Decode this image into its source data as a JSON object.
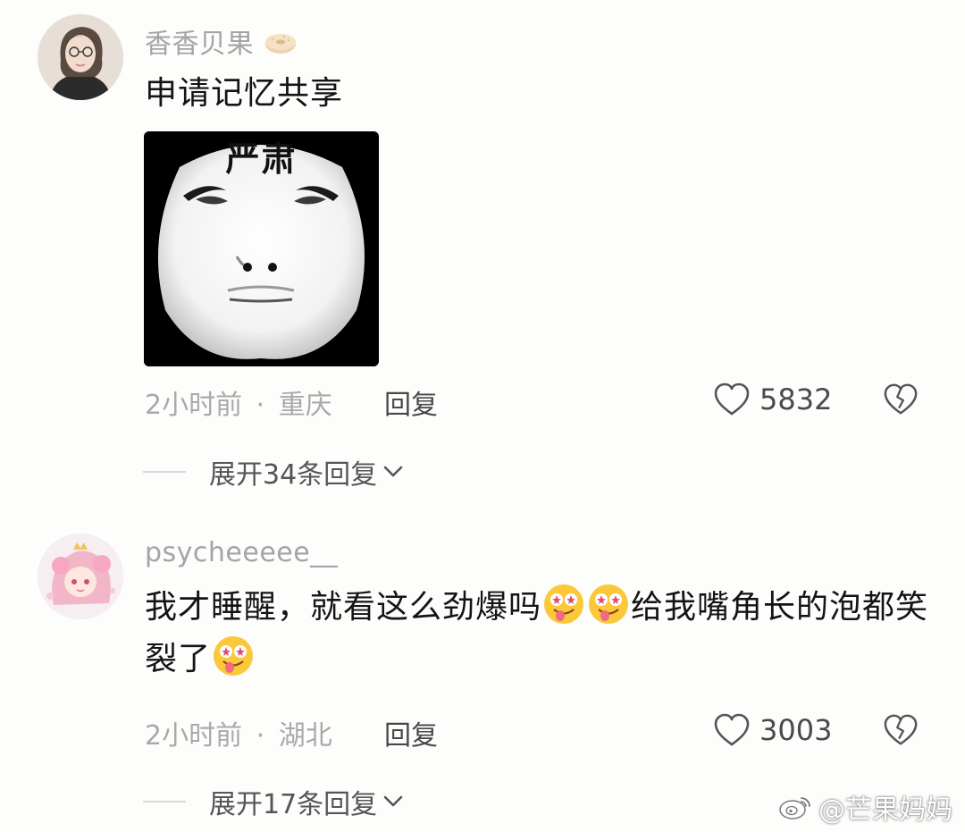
{
  "comments": [
    {
      "username": "香香贝果",
      "username_badge": "bagel-emoji",
      "text": "申请记忆共享",
      "sticker_caption": "严肃",
      "time": "2小时前",
      "location": "重庆",
      "reply_label": "回复",
      "likes": "5832",
      "expand_label": "展开34条回复"
    },
    {
      "username": "psycheeeee__",
      "text_parts": [
        "我才睡醒，就看这么劲爆吗",
        "给我嘴角长的泡都笑裂了"
      ],
      "time": "2小时前",
      "location": "湖北",
      "reply_label": "回复",
      "likes": "3003",
      "expand_label": "展开17条回复"
    }
  ],
  "meta_separator": "·",
  "watermark": "@芒果妈妈",
  "icons": {
    "like": "heart-outline-icon",
    "dislike": "broken-heart-icon",
    "expand": "chevron-down-icon",
    "emoji": "star-eyes-tongue-emoji"
  },
  "colors": {
    "background": "#fdfdfb",
    "username": "#a4a4a4",
    "text": "#141414",
    "meta": "#a9a9a9"
  }
}
